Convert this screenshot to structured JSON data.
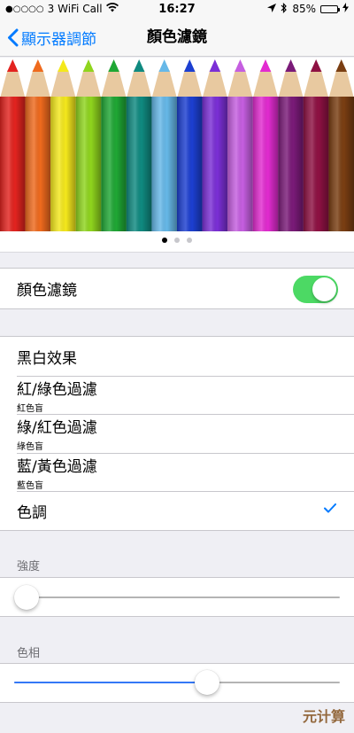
{
  "status_bar": {
    "carrier": "3 WiFi Call",
    "time": "16:27",
    "battery_percent": "85%",
    "battery_level": 0.85
  },
  "nav": {
    "back_label": "顯示器調節",
    "title": "顏色濾鏡"
  },
  "preview": {
    "pencil_colors": [
      "#e3231f",
      "#ef6a1d",
      "#f4e81c",
      "#8fd51d",
      "#1fa734",
      "#0f8a80",
      "#66b8e8",
      "#1c3fd1",
      "#7b2fd6",
      "#c55ee0",
      "#e22bd0",
      "#7a1a78",
      "#8e1143",
      "#7a3e12"
    ],
    "page_count": 3,
    "active_page": 0
  },
  "filter_toggle": {
    "label": "顏色濾鏡",
    "on": true
  },
  "filters": [
    {
      "label": "黑白效果",
      "sub": "",
      "selected": false
    },
    {
      "label": "紅/綠色過濾",
      "sub": "紅色盲",
      "selected": false
    },
    {
      "label": "綠/紅色過濾",
      "sub": "綠色盲",
      "selected": false
    },
    {
      "label": "藍/黃色過濾",
      "sub": "藍色盲",
      "selected": false
    },
    {
      "label": "色調",
      "sub": "",
      "selected": true
    }
  ],
  "intensity": {
    "header": "強度",
    "value": 0.0
  },
  "hue": {
    "header": "色相",
    "value": 0.6
  },
  "watermark": "元计算",
  "colors": {
    "accent": "#007aff",
    "toggle_on": "#4cd964",
    "slider_fill": "#3478f6"
  }
}
